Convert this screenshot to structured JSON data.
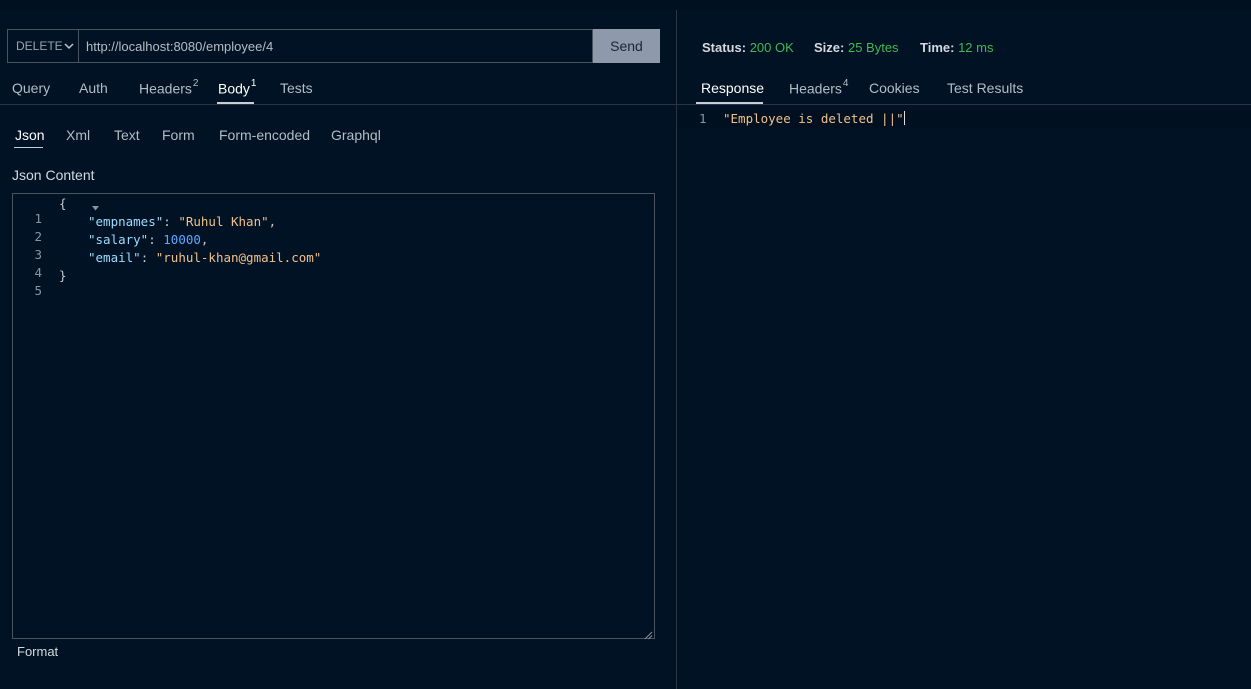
{
  "request": {
    "method": "DELETE",
    "url": "http://localhost:8080/employee/4",
    "send_label": "Send",
    "tabs": [
      {
        "label": "Query",
        "badge": ""
      },
      {
        "label": "Auth",
        "badge": ""
      },
      {
        "label": "Headers",
        "badge": "2"
      },
      {
        "label": "Body",
        "badge": "1"
      },
      {
        "label": "Tests",
        "badge": ""
      }
    ],
    "active_tab": "Body",
    "body_types": [
      "Json",
      "Xml",
      "Text",
      "Form",
      "Form-encoded",
      "Graphql"
    ],
    "active_body_type": "Json",
    "content_label": "Json Content",
    "editor": {
      "line_numbers": [
        "1",
        "2",
        "3",
        "4",
        "5"
      ],
      "open_brace": "{",
      "close_brace": "}",
      "fields": [
        {
          "key": "\"empnames\"",
          "value": "\"Ruhul Khan\"",
          "type": "string",
          "trailing": ","
        },
        {
          "key": "\"salary\"",
          "value": "10000",
          "type": "number",
          "trailing": ","
        },
        {
          "key": "\"email\"",
          "value": "\"ruhul-khan@gmail.com\"",
          "type": "string",
          "trailing": ""
        }
      ]
    },
    "format_label": "Format"
  },
  "response": {
    "status_label": "Status:",
    "status_value": "200 OK",
    "size_label": "Size:",
    "size_value": "25 Bytes",
    "time_label": "Time:",
    "time_value": "12 ms",
    "tabs": [
      {
        "label": "Response",
        "badge": ""
      },
      {
        "label": "Headers",
        "badge": "4"
      },
      {
        "label": "Cookies",
        "badge": ""
      },
      {
        "label": "Test Results",
        "badge": ""
      }
    ],
    "active_tab": "Response",
    "body_line_number": "1",
    "body_text": "\"Employee is deleted ||\""
  },
  "colors": {
    "background": "#011224",
    "status_ok": "#3fb950",
    "json_key": "#9cdcfe",
    "json_string": "#f0c08a",
    "json_number": "#5aa8ff",
    "send_button": "#8e99ab"
  }
}
